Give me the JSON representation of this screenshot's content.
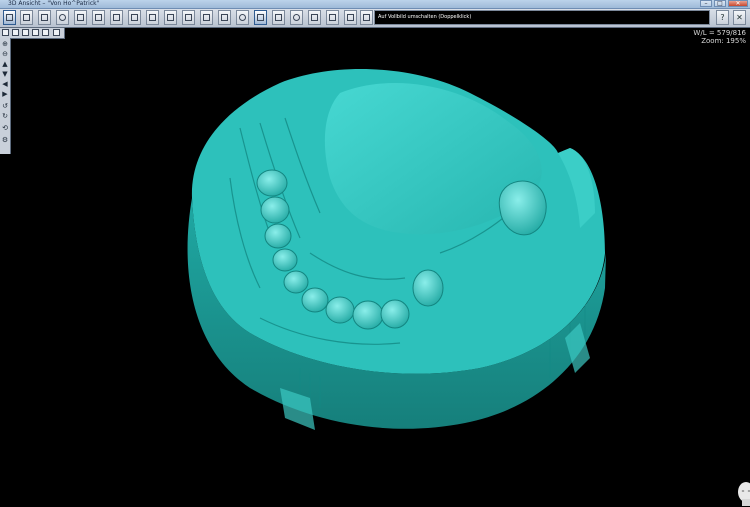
{
  "window": {
    "title": "3D Ansicht – \"Von Ho^Patrick\"",
    "minimize": "–",
    "maximize": "□",
    "close": "✕"
  },
  "toolbar": {
    "status_text": "Auf Vollbild umschalten (Doppelklick)",
    "help_label": "?",
    "exit_label": "✕"
  },
  "viewport": {
    "wl_label": "W/L = 579/816",
    "zoom_label": "Zoom: 195%",
    "model_color": "#2fc7c1"
  },
  "left_toolbar": {
    "icons": [
      "zoom-in-icon",
      "zoom-out-icon",
      "arrow-up-icon",
      "arrow-down-icon",
      "arrow-left-icon",
      "arrow-right-icon",
      "rotate-ccw-icon",
      "rotate-cw-icon",
      "reset-icon",
      "settings-icon"
    ]
  }
}
